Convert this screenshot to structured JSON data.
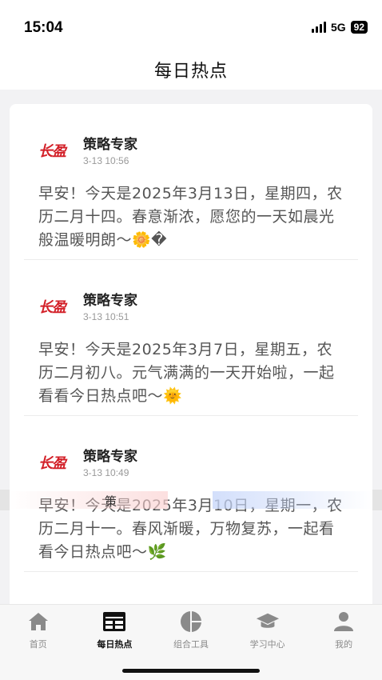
{
  "status_bar": {
    "time": "15:04",
    "network": "5G",
    "battery": "92"
  },
  "header": {
    "title": "每日热点"
  },
  "posts": [
    {
      "logo_text": "长盈",
      "author": "策略专家",
      "time": "3-13 10:56",
      "body": "早安！今天是2025年3月13日，星期四，农历二月十四。春意渐浓，愿您的一天如晨光般温暖明朗～🌼�"
    },
    {
      "logo_text": "长盈",
      "author": "策略专家",
      "time": "3-13 10:51",
      "body": "早安！今天是2025年3月7日，星期五，农历二月初八。元气满满的一天开始啦，一起看看今日热点吧～🌞"
    },
    {
      "logo_text": "长盈",
      "author": "策略专家",
      "time": "3-13 10:49",
      "body": "早安！今天是2025年3月10日，星期一，农历二月十一。春风渐暖，万物复苏，一起看看今日热点吧～🌿"
    }
  ],
  "overlay": {
    "text": "策"
  },
  "tabs": [
    {
      "label": "首页",
      "icon": "home-icon",
      "active": false
    },
    {
      "label": "每日热点",
      "icon": "calendar-news-icon",
      "active": true
    },
    {
      "label": "组合工具",
      "icon": "pie-chart-icon",
      "active": false
    },
    {
      "label": "学习中心",
      "icon": "graduation-cap-icon",
      "active": false
    },
    {
      "label": "我的",
      "icon": "user-icon",
      "active": false
    }
  ],
  "colors": {
    "brand_red": "#d32028",
    "tab_inactive": "#8a8a8a",
    "tab_active": "#111111"
  }
}
